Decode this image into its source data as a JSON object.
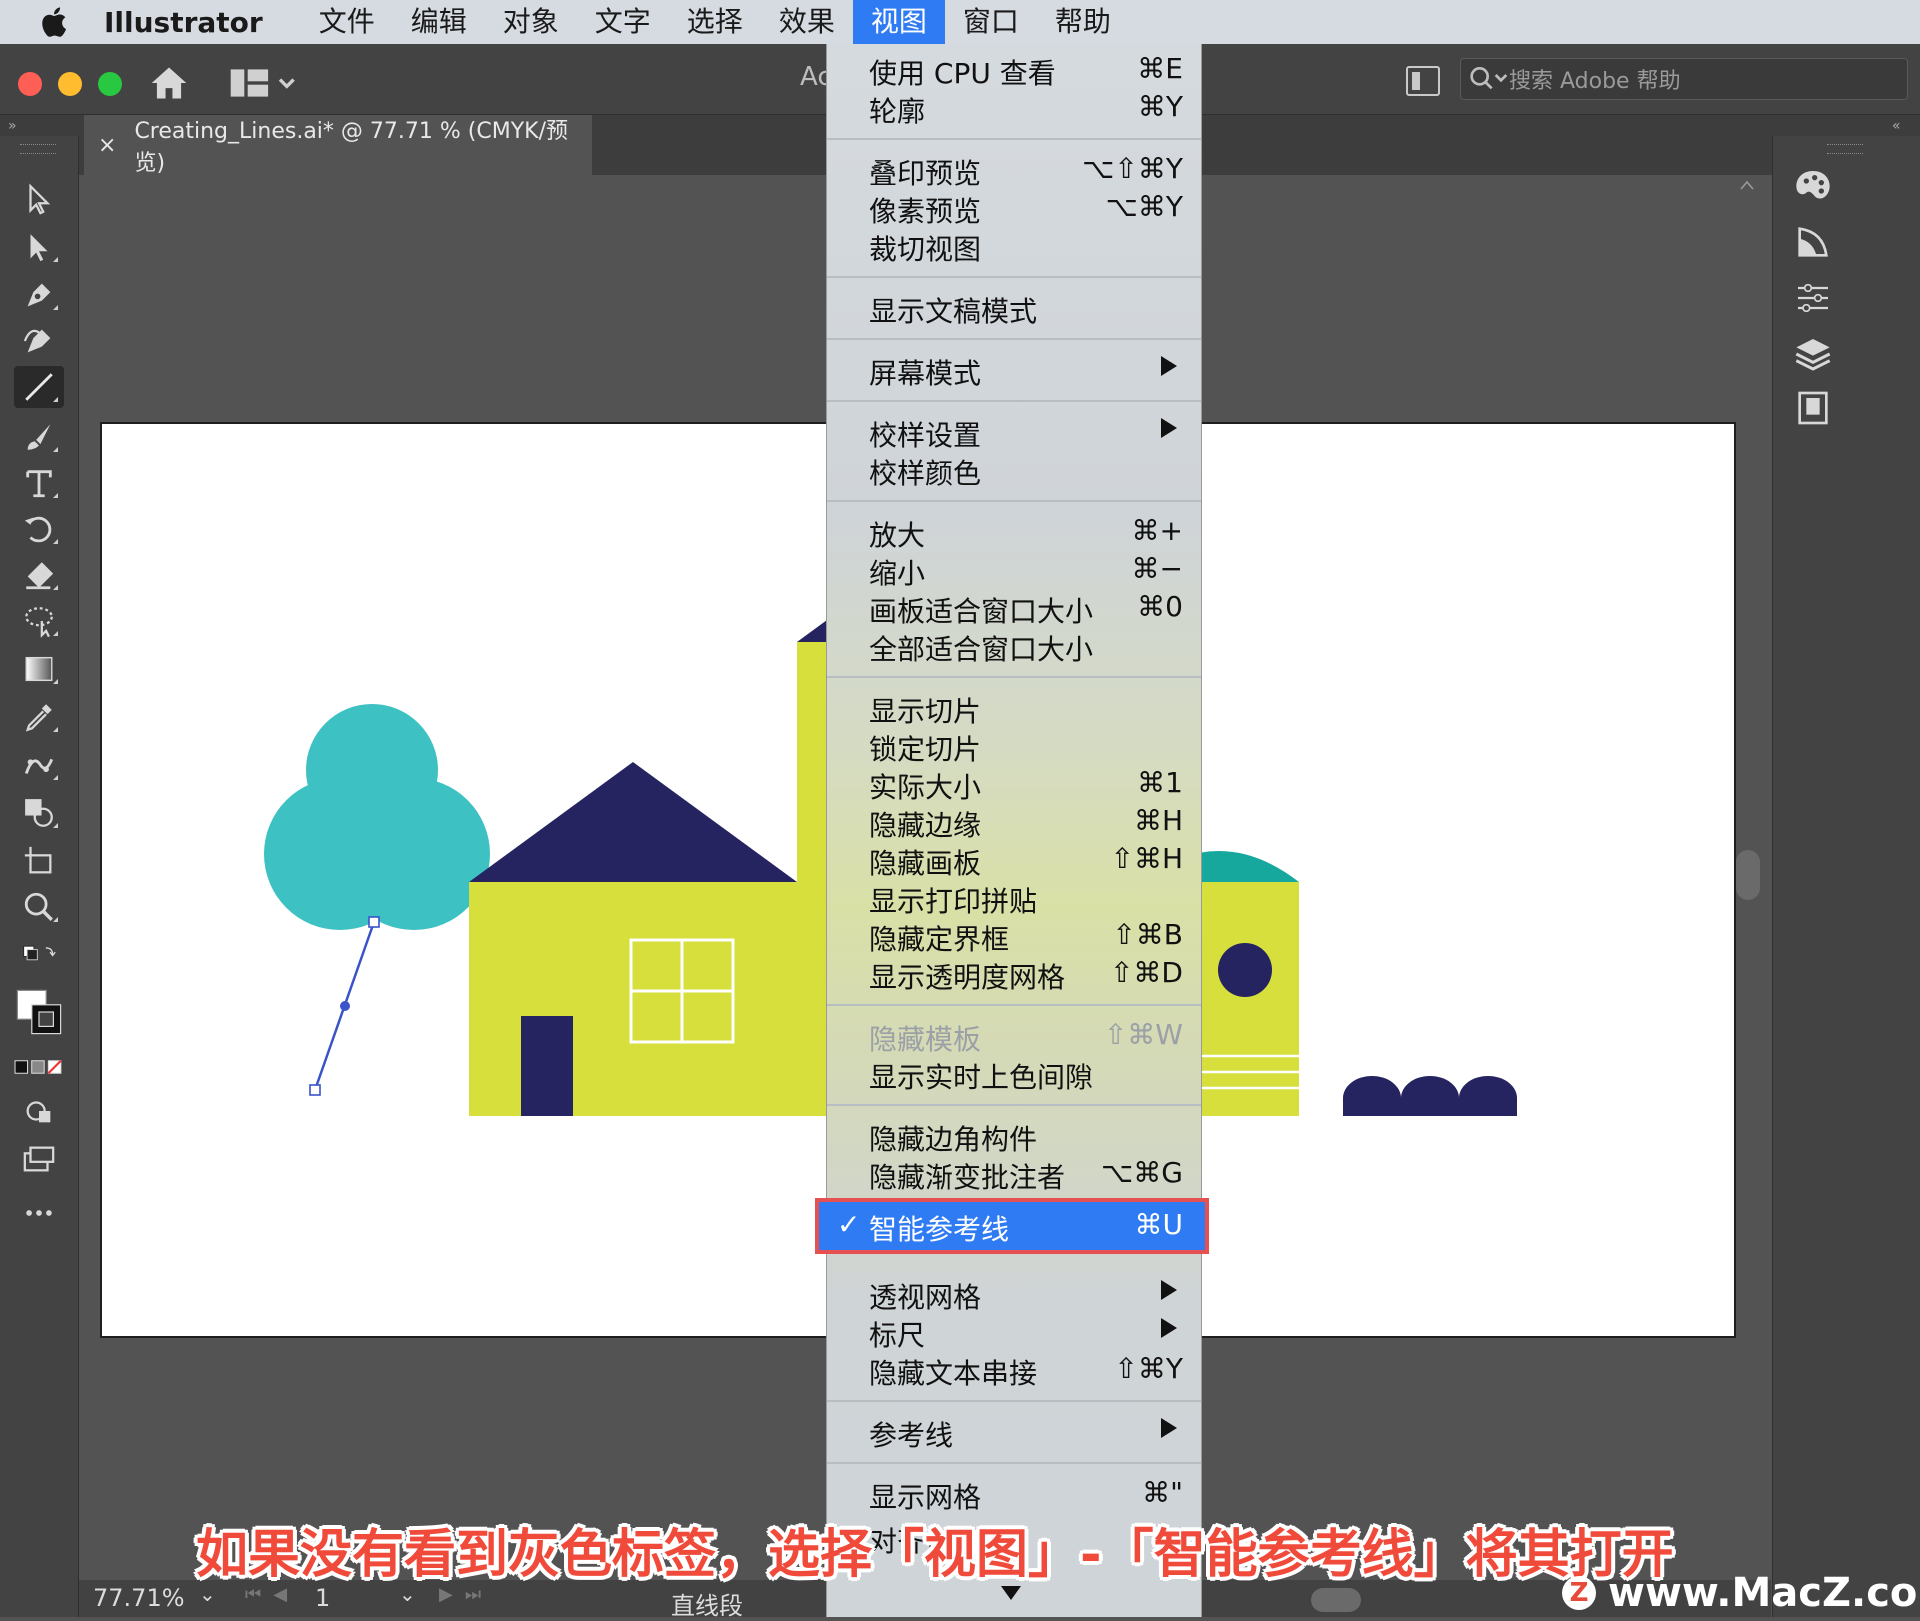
{
  "menubar": {
    "app_name": "Illustrator",
    "items": [
      "文件",
      "编辑",
      "对象",
      "文字",
      "选择",
      "效果",
      "视图",
      "窗口",
      "帮助"
    ],
    "active_index": 6
  },
  "header": {
    "title_fragment": "Ac",
    "search_placeholder": "搜索 Adobe 帮助"
  },
  "document_tab": {
    "close_glyph": "×",
    "title": "Creating_Lines.ai* @ 77.71 % (CMYK/预览)"
  },
  "view_menu": {
    "items": [
      {
        "label": "使用 CPU 查看",
        "shortcut": "⌘E"
      },
      {
        "label": "轮廓",
        "shortcut": "⌘Y"
      },
      {
        "label": "叠印预览",
        "shortcut": "⌥⇧⌘Y"
      },
      {
        "label": "像素预览",
        "shortcut": "⌥⌘Y"
      },
      {
        "label": "裁切视图",
        "shortcut": ""
      },
      {
        "label": "显示文稿模式",
        "shortcut": ""
      },
      {
        "label": "屏幕模式",
        "shortcut": "",
        "submenu": true
      },
      {
        "label": "校样设置",
        "shortcut": "",
        "submenu": true
      },
      {
        "label": "校样颜色",
        "shortcut": ""
      },
      {
        "label": "放大",
        "shortcut": "⌘+"
      },
      {
        "label": "缩小",
        "shortcut": "⌘−"
      },
      {
        "label": "画板适合窗口大小",
        "shortcut": "⌘0"
      },
      {
        "label": "全部适合窗口大小",
        "shortcut": ""
      },
      {
        "label": "显示切片",
        "shortcut": ""
      },
      {
        "label": "锁定切片",
        "shortcut": ""
      },
      {
        "label": "实际大小",
        "shortcut": "⌘1"
      },
      {
        "label": "隐藏边缘",
        "shortcut": "⌘H"
      },
      {
        "label": "隐藏画板",
        "shortcut": "⇧⌘H"
      },
      {
        "label": "显示打印拼贴",
        "shortcut": ""
      },
      {
        "label": "隐藏定界框",
        "shortcut": "⇧⌘B"
      },
      {
        "label": "显示透明度网格",
        "shortcut": "⇧⌘D"
      },
      {
        "label": "隐藏模板",
        "shortcut": "⇧⌘W",
        "disabled": true
      },
      {
        "label": "显示实时上色间隙",
        "shortcut": ""
      },
      {
        "label": "隐藏边角构件",
        "shortcut": ""
      },
      {
        "label": "隐藏渐变批注者",
        "shortcut": "⌥⌘G"
      },
      {
        "label": "智能参考线",
        "shortcut": "⌘U",
        "checked": true,
        "highlighted": true
      },
      {
        "label": "透视网格",
        "shortcut": "",
        "submenu": true
      },
      {
        "label": "标尺",
        "shortcut": "",
        "submenu": true
      },
      {
        "label": "隐藏文本串接",
        "shortcut": "⇧⌘Y"
      },
      {
        "label": "参考线",
        "shortcut": "",
        "submenu": true
      },
      {
        "label": "显示网格",
        "shortcut": "⌘\""
      },
      {
        "label": "对齐像素",
        "shortcut": ""
      }
    ],
    "check_glyph": "✓"
  },
  "statusbar": {
    "zoom": "77.71%",
    "artboard_number": "1",
    "tool_name": "直线段"
  },
  "caption": "如果没有看到灰色标签，选择「视图」-「智能参考线」将其打开",
  "watermark": {
    "logo_letter": "Z",
    "text": "www.MacZ.com"
  },
  "colors": {
    "menu_highlight": "#2f7bf3",
    "annotation_red": "#e55050",
    "art_teal": "#3ec1c3",
    "art_navy": "#252360",
    "art_yellow_green": "#d6df3c",
    "art_dark_teal": "#17a89d"
  }
}
